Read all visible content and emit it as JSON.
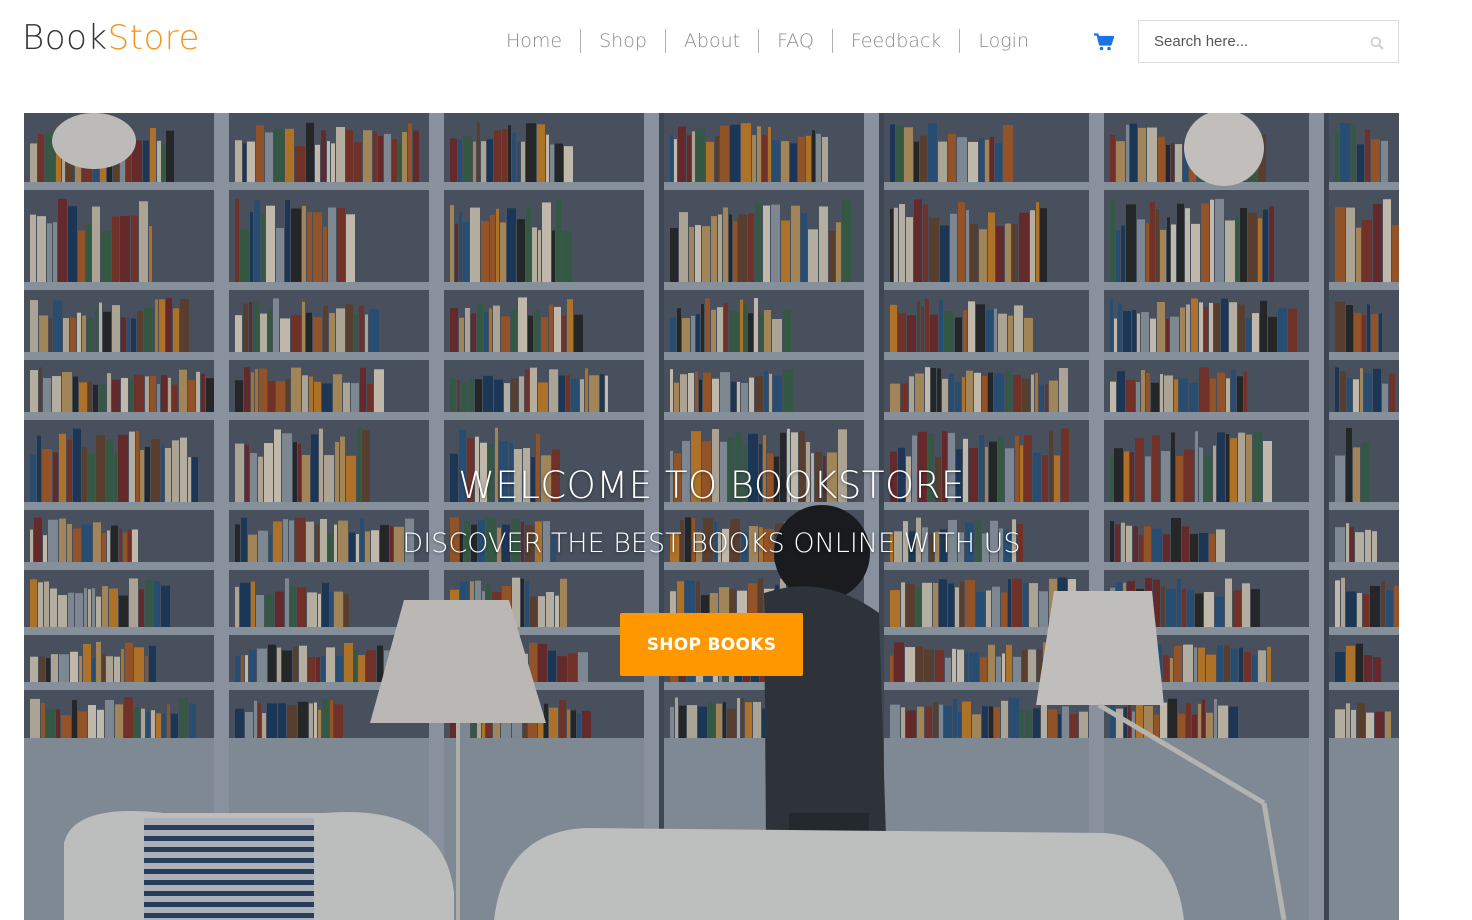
{
  "logo": {
    "part1": "Book",
    "part2": "Store"
  },
  "nav": {
    "items": [
      {
        "label": "Home"
      },
      {
        "label": "Shop"
      },
      {
        "label": "About"
      },
      {
        "label": "FAQ"
      },
      {
        "label": "Feedback"
      },
      {
        "label": "Login"
      }
    ],
    "cart_icon": "shopping-cart-icon"
  },
  "search": {
    "placeholder": "Search here...",
    "value": "",
    "icon": "search-icon"
  },
  "hero": {
    "title": "WELCOME TO BOOKSTORE",
    "subtitle": "DISCOVER THE BEST BOOKS ONLINE WITH US",
    "button_label": "SHOP BOOKS"
  },
  "colors": {
    "accent": "#f7941d",
    "button": "#ff9800",
    "cart": "#1a73e8",
    "nav_text": "#8a8a8a"
  }
}
